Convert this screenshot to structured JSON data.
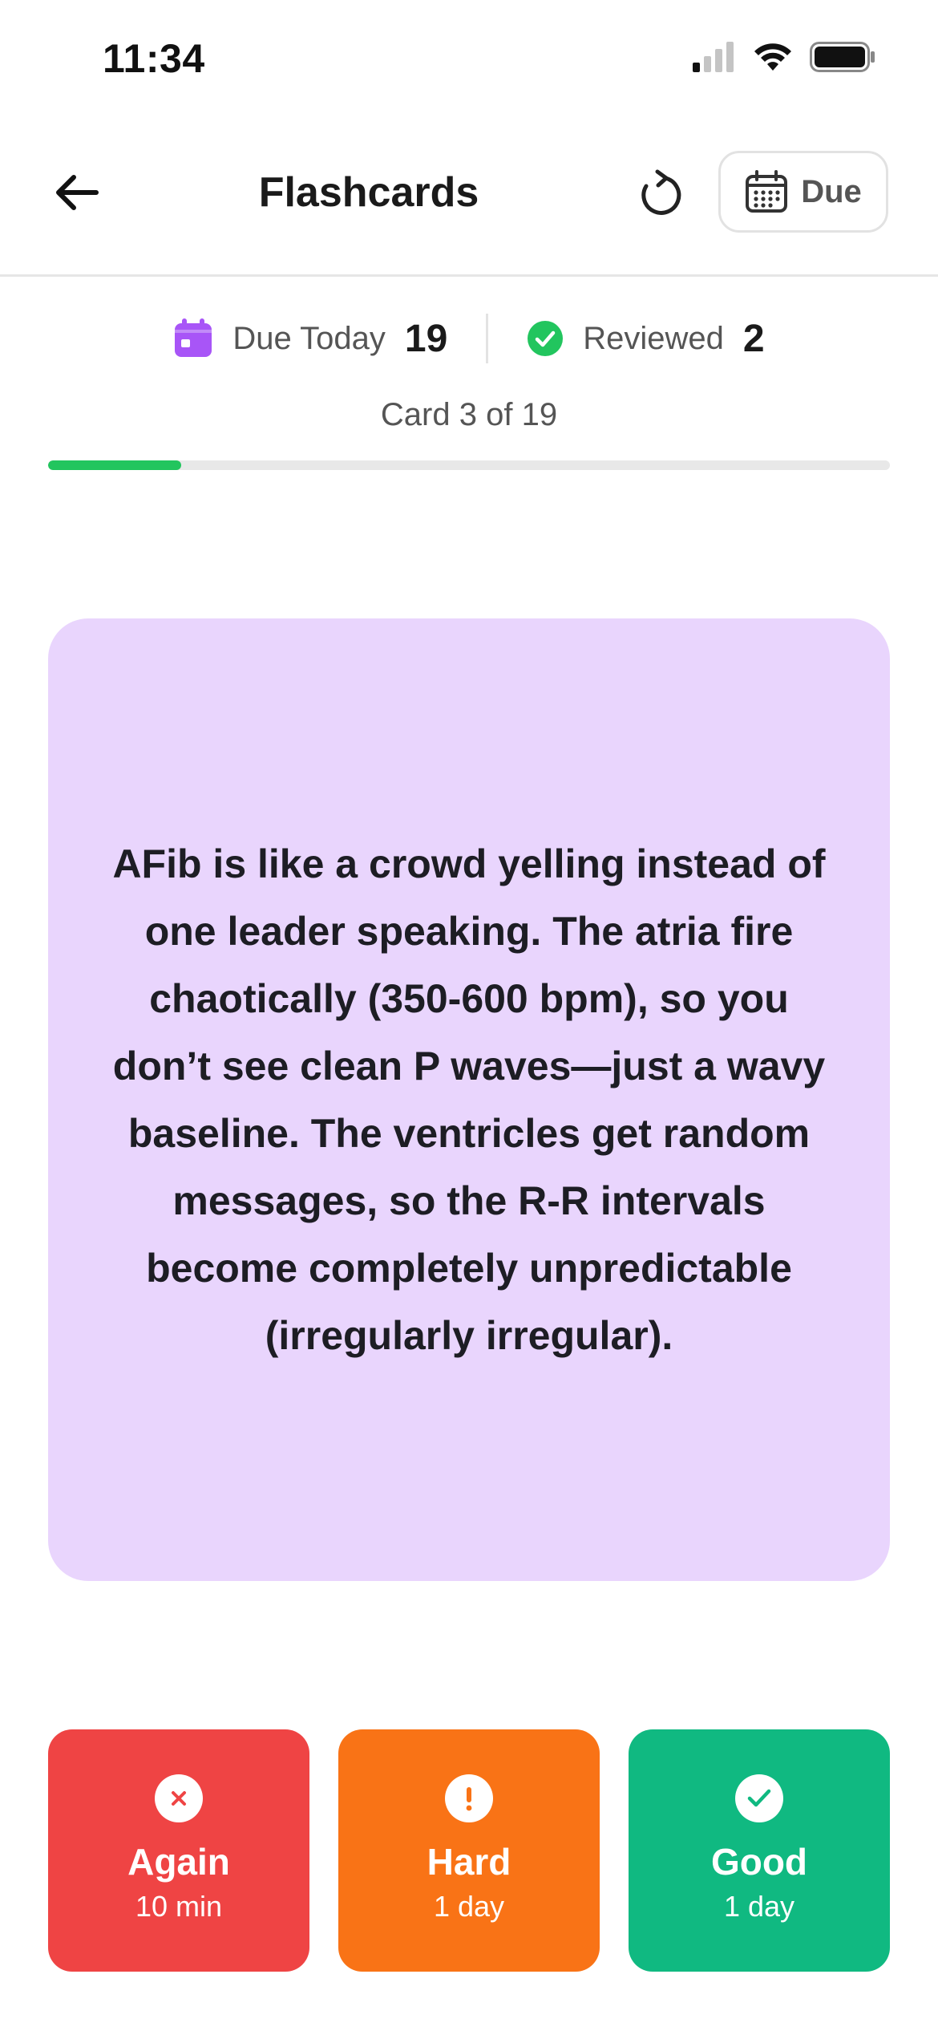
{
  "status_bar": {
    "time": "11:34"
  },
  "header": {
    "title": "Flashcards",
    "due_button_label": "Due"
  },
  "stats": {
    "due_today_label": "Due Today",
    "due_today_value": "19",
    "reviewed_label": "Reviewed",
    "reviewed_value": "2"
  },
  "progress": {
    "text": "Card 3 of 19",
    "current": 3,
    "total": 19,
    "fraction": 0.158
  },
  "card": {
    "text": "AFib is like a crowd yelling instead of one leader speaking. The atria fire chaotically (350-600 bpm), so you don’t see clean P waves—just a wavy baseline. The ventricles get random messages, so the R-R intervals become completely unpredictable (irregularly irregular)."
  },
  "answers": [
    {
      "label": "Again",
      "interval": "10 min",
      "icon": "x-circle-icon",
      "color": "#ef4444"
    },
    {
      "label": "Hard",
      "interval": "1 day",
      "icon": "exclamation-circle-icon",
      "color": "#f97316"
    },
    {
      "label": "Good",
      "interval": "1 day",
      "icon": "check-circle-icon",
      "color": "#10b981"
    }
  ],
  "colors": {
    "card_background": "#e9d5fd",
    "progress_fill": "#22c55e",
    "calendar_icon": "#a855f7",
    "reviewed_icon": "#22c55e"
  }
}
